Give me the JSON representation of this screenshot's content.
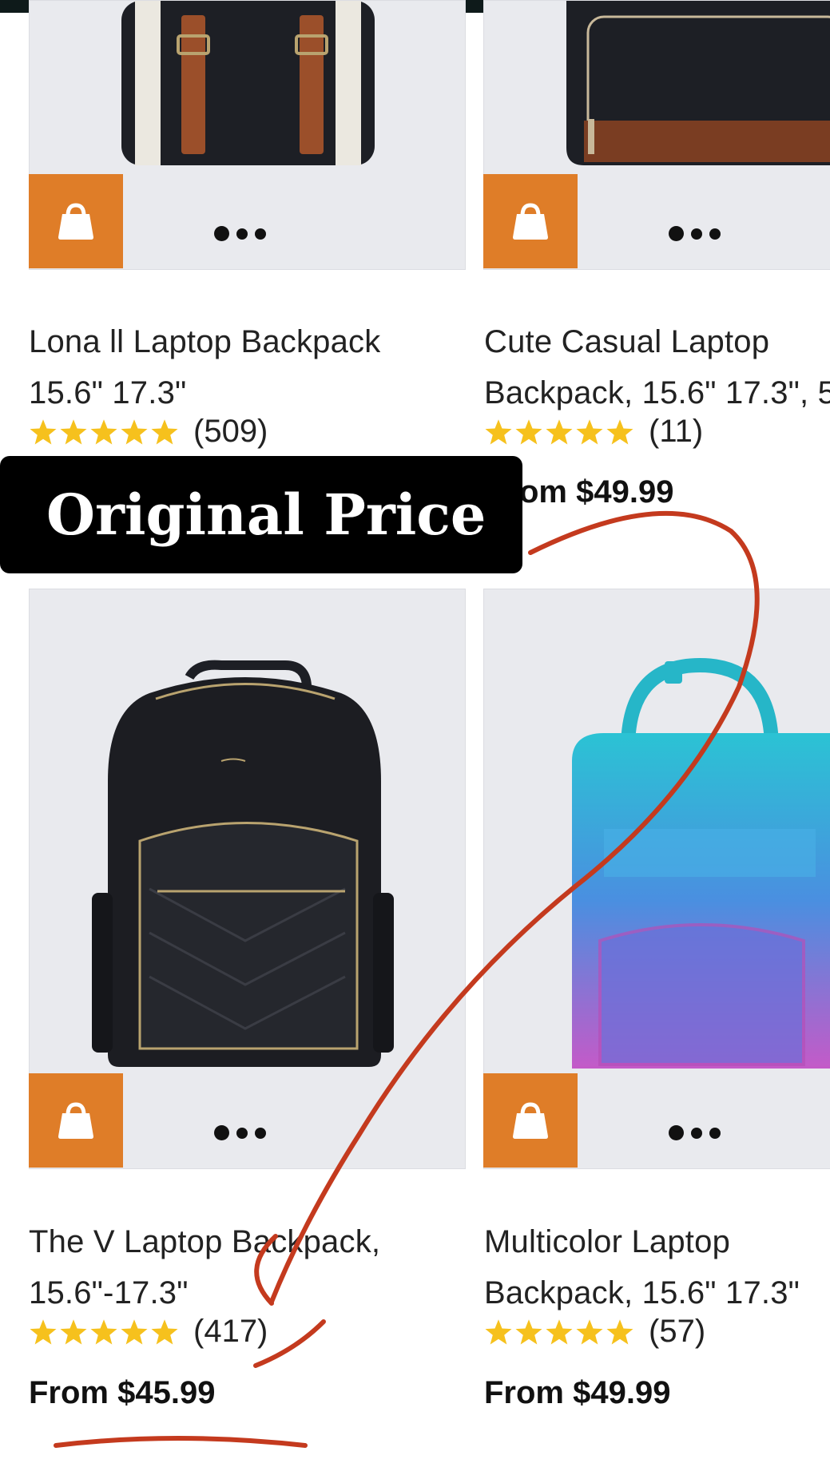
{
  "overlay": {
    "label": "Original Price"
  },
  "products": [
    {
      "title_lines": [
        "Lona ll Laptop Backpack",
        "15.6\" 17.3\""
      ],
      "rating_count": "(509)",
      "price": ""
    },
    {
      "title_lines": [
        "Cute Casual Laptop",
        "Backpack, 15.6\" 17.3\", 5"
      ],
      "rating_count": "(11)",
      "price": "om $49.99"
    },
    {
      "title_lines": [
        "The V Laptop Backpack,",
        "15.6\"-17.3\""
      ],
      "rating_count": "(417)",
      "price": "From $45.99"
    },
    {
      "title_lines": [
        "Multicolor Laptop",
        "Backpack, 15.6\" 17.3\""
      ],
      "rating_count": "(57)",
      "price": "From $49.99"
    }
  ],
  "icons": {
    "cart": "shopping-bag-icon",
    "more": "more-dots-icon",
    "star": "star-icon"
  },
  "colors": {
    "accent": "#df7d28",
    "star": "#f6c11d",
    "annotation": "#c43a1e",
    "image_bg": "#e9eaee"
  }
}
